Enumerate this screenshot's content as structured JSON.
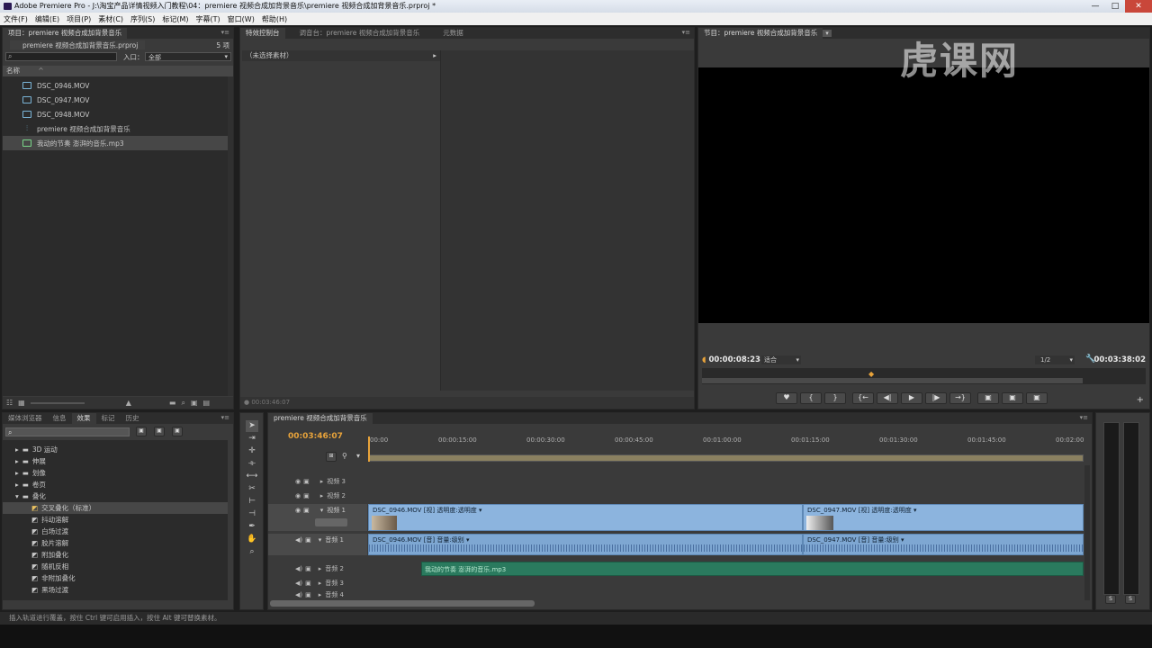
{
  "window": {
    "title": "Adobe Premiere Pro - J:\\淘宝产品详情视频入门教程\\04：premiere 视频合成加背景音乐\\premiere 视频合成加背景音乐.prproj *",
    "buttons": [
      "—",
      "□",
      "✕"
    ]
  },
  "menu": [
    "文件(F)",
    "编辑(E)",
    "项目(P)",
    "素材(C)",
    "序列(S)",
    "标记(M)",
    "字幕(T)",
    "窗口(W)",
    "帮助(H)"
  ],
  "watermark": "虎课网",
  "project_panel": {
    "tab": "项目：premiere 视频合成加背景音乐",
    "project_file": "premiere 视频合成加背景音乐.prproj",
    "item_count": "5 项",
    "search_placeholder": "",
    "inlet_label": "入口：",
    "inlet_value": "全部",
    "column_header": "名称",
    "items": [
      {
        "name": "DSC_0946.MOV",
        "kind": "video"
      },
      {
        "name": "DSC_0947.MOV",
        "kind": "video"
      },
      {
        "name": "DSC_0948.MOV",
        "kind": "video"
      },
      {
        "name": "premiere 视频合成加背景音乐",
        "kind": "sequence"
      },
      {
        "name": "我动的节奏 澎湃的音乐.mp3",
        "kind": "audio"
      }
    ]
  },
  "effect_controls": {
    "tabs": [
      "特效控制台",
      "调音台：premiere 视频合成加背景音乐",
      "元数据"
    ],
    "no_clip": "（未选择素材）",
    "timecode": "00:03:46:07"
  },
  "program_monitor": {
    "tab": "节目：premiere 视频合成加背景音乐",
    "current_time": "00:00:08:23",
    "fit": "适合",
    "resolution": "1/2",
    "duration": "00:03:38:02",
    "transport": [
      "♥",
      "{",
      "}",
      "{←",
      "◀|",
      "▶",
      "|▶",
      "→}",
      "▣",
      "▣",
      "▣"
    ]
  },
  "effects_panel": {
    "tabs": [
      "媒体浏览器",
      "信息",
      "效果",
      "标记",
      "历史"
    ],
    "search_value": "",
    "categories": [
      "3D 运动",
      "伸展",
      "划像",
      "卷页",
      "叠化"
    ],
    "transitions": [
      "交叉叠化（标准）",
      "抖动溶解",
      "白场过渡",
      "胶片溶解",
      "附加叠化",
      "随机反相",
      "非附加叠化",
      "黑场过渡"
    ]
  },
  "timeline": {
    "tab": "premiere 视频合成加背景音乐",
    "timecode": "00:03:46:07",
    "ruler": [
      "00:00",
      "00:00:15:00",
      "00:00:30:00",
      "00:00:45:00",
      "00:01:00:00",
      "00:01:15:00",
      "00:01:30:00",
      "00:01:45:00",
      "00:02:00"
    ],
    "tracks": {
      "video3": "视频 3",
      "video2": "视频 2",
      "video1": "视频 1",
      "audio1": "音频 1",
      "audio2": "音频 2",
      "audio3": "音频 3",
      "audio4": "音频 4"
    },
    "clips": {
      "v1a": "DSC_0946.MOV [视]  透明度:透明度 ▾",
      "v1b": "DSC_0947.MOV [视]  透明度:透明度 ▾",
      "a1a": "DSC_0946.MOV [音]  音量:级别 ▾",
      "a1b": "DSC_0947.MOV [音]  音量:级别 ▾",
      "a2": "我动的节奏 澎湃的音乐.mp3"
    }
  },
  "status_bar": "插入轨道进行覆盖，按住 Ctrl 键可启用插入，按住 Alt 键可替换素材。",
  "colors": {
    "accent_timecode": "#e8a33a",
    "video_clip": "#8cb4de",
    "audio_clip": "#7ea7d2",
    "music_clip": "#2a7a5e"
  }
}
